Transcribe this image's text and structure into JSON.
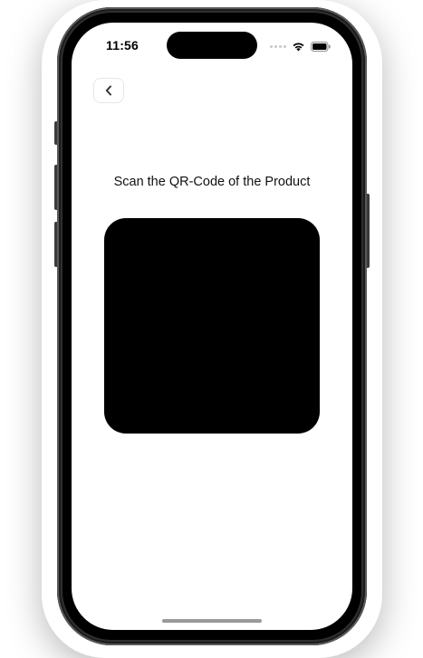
{
  "status_bar": {
    "time": "11:56",
    "signal_icon": "cellular-signal-dots-icon",
    "wifi_icon": "wifi-icon",
    "battery_icon": "battery-icon"
  },
  "navigation": {
    "back_icon": "chevron-left-icon"
  },
  "main": {
    "title": "Scan the QR-Code of the Product"
  },
  "colors": {
    "background": "#ffffff",
    "scanner_background": "#000000",
    "text": "#111111"
  }
}
